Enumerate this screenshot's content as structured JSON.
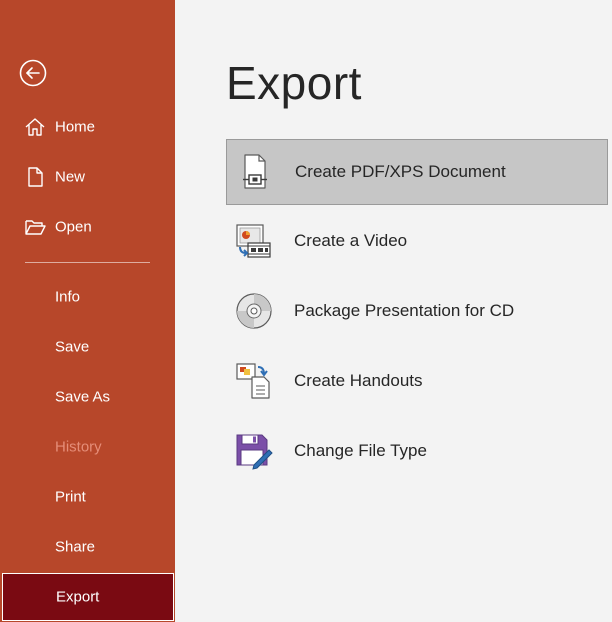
{
  "sidebar": {
    "back_icon": "back-arrow-icon",
    "items": [
      {
        "label": "Home",
        "icon": "home-icon",
        "state": "normal"
      },
      {
        "label": "New",
        "icon": "new-document-icon",
        "state": "normal"
      },
      {
        "label": "Open",
        "icon": "open-folder-icon",
        "state": "normal"
      },
      {
        "label": "Info",
        "state": "normal"
      },
      {
        "label": "Save",
        "state": "normal"
      },
      {
        "label": "Save As",
        "state": "normal"
      },
      {
        "label": "History",
        "state": "disabled"
      },
      {
        "label": "Print",
        "state": "normal"
      },
      {
        "label": "Share",
        "state": "normal"
      },
      {
        "label": "Export",
        "state": "selected"
      }
    ]
  },
  "main": {
    "title": "Export",
    "options": [
      {
        "label": "Create PDF/XPS Document",
        "icon": "pdf-document-icon",
        "selected": true
      },
      {
        "label": "Create a Video",
        "icon": "video-icon",
        "selected": false
      },
      {
        "label": "Package Presentation for CD",
        "icon": "cd-icon",
        "selected": false
      },
      {
        "label": "Create Handouts",
        "icon": "handouts-icon",
        "selected": false
      },
      {
        "label": "Change File Type",
        "icon": "change-file-type-icon",
        "selected": false
      }
    ]
  },
  "colors": {
    "sidebar_bg": "#b7472a",
    "sidebar_selected_bg": "#7a0a12",
    "disabled_text": "#e58d78",
    "main_bg": "#f3f3f3",
    "option_selected_bg": "#c6c6c6"
  }
}
